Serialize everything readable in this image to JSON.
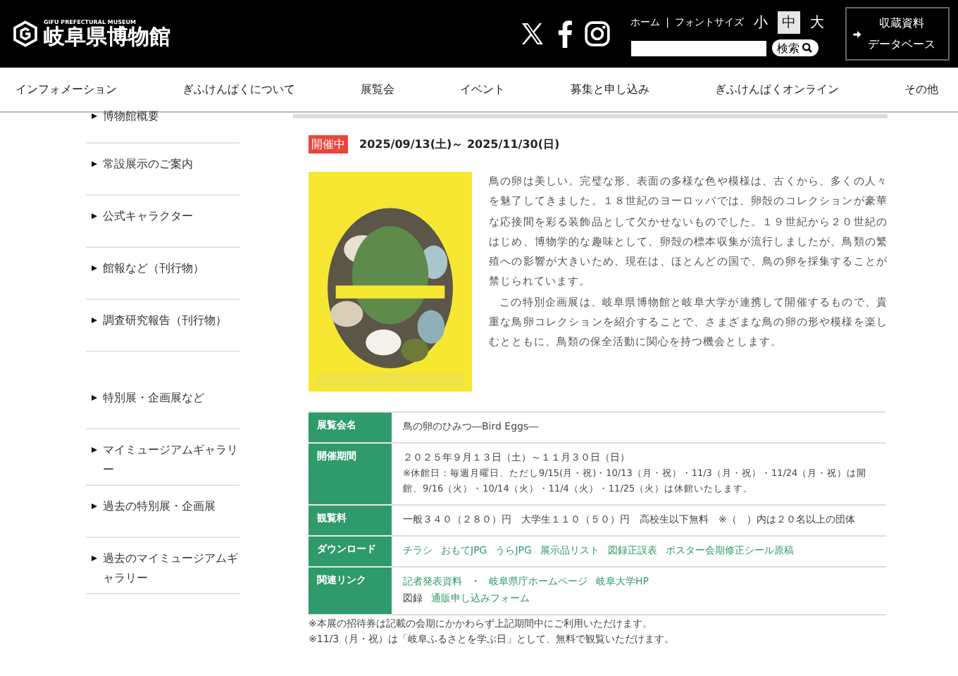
{
  "header": {
    "logo_caption": "GIFU PREFECTURAL MUSEUM",
    "logo_title": "岐阜県博物館",
    "top_links": [
      "ホーム",
      "|",
      "フォントサイズ"
    ],
    "font_sizes": [
      {
        "label": "小",
        "selected": false
      },
      {
        "label": "中",
        "selected": true
      },
      {
        "label": "大",
        "selected": false
      }
    ],
    "search_button": "検索",
    "database_button": [
      "収蔵資料",
      "データベース"
    ]
  },
  "nav": [
    "インフォメーション",
    "ぎふけんぱくについて",
    "展覧会",
    "イベント",
    "募集と申し込み",
    "ぎふけんぱくオンライン",
    "その他"
  ],
  "sidebar": {
    "groups": [
      [
        "博物館概要",
        "常設展示のご案内",
        "公式キャラクター",
        "館報など（刊行物）",
        "調査研究報告（刊行物）"
      ],
      [
        "特別展・企画展など",
        "マイミュージアムギャラリー",
        "過去の特別展・企画展",
        "過去のマイミュージアムギャラリー"
      ]
    ]
  },
  "exhibit": {
    "status": "開催中",
    "dates": "2025/09/13(土)～ 2025/11/30(日)",
    "poster": {
      "kind": "picture"
    },
    "paragraphs": [
      "鳥の卵は美しい。完璧な形、表面の多様な色や模様は、古くから、多くの人々を魅了してきました。１８世紀のヨーロッパでは、卵殻のコレクションが豪華な応接間を彩る装飾品として欠かせないものでした。１９世紀から２０世紀のはじめ、博物学的な趣味として、卵殻の標本収集が流行しましたが、鳥類の繁殖への影響が大きいため、現在は、ほとんどの国で、鳥の卵を採集することが禁じられています。",
      "この特別企画展は、岐阜県博物館と岐阜大学が連携して開催するもので、貴重な鳥卵コレクションを紹介することで、さまざまな鳥の卵の形や模様を楽しむとともに、鳥類の保全活動に関心を持つ機会とします。"
    ],
    "table": [
      {
        "label": "展覧会名",
        "lines": [
          [
            {
              "kind": "text",
              "text": "鳥の卵のひみつ―Bird Eggs―"
            }
          ]
        ]
      },
      {
        "label": "開催期間",
        "lines": [
          [
            {
              "kind": "text",
              "text": "２０２５年９月１３日（土）～１１月３０日（日）"
            }
          ],
          [
            {
              "kind": "small",
              "text": "※休館日：毎週月曜日、ただし9/15(月・祝)・10/13（月・祝）・11/3（月・祝）・11/24（月・祝）は開館、9/16（火）・10/14（火）・11/4（火）・11/25（火）は休館いたします。"
            }
          ]
        ]
      },
      {
        "label": "観覧料",
        "lines": [
          [
            {
              "kind": "text",
              "text": "一般３４０（２８０）円　大学生１１０（５０）円　高校生以下無料　※（　）内は２０名以上の団体"
            }
          ]
        ]
      },
      {
        "label": "ダウンロード",
        "lines": [
          [
            {
              "kind": "link",
              "text": "チラシ"
            },
            {
              "kind": "link",
              "text": "おもてJPG"
            },
            {
              "kind": "link",
              "text": "うらJPG"
            },
            {
              "kind": "link",
              "text": "展示品リスト"
            },
            {
              "kind": "link",
              "text": "図録正誤表"
            },
            {
              "kind": "link",
              "text": "ポスター会期修正シール原稿"
            }
          ]
        ]
      },
      {
        "label": "関連リンク",
        "lines": [
          [
            {
              "kind": "link",
              "text": "記者発表資料"
            },
            {
              "kind": "text",
              "text": "・"
            },
            {
              "kind": "link",
              "text": "岐阜県庁ホームページ"
            },
            {
              "kind": "link",
              "text": "岐阜大学HP"
            }
          ],
          [
            {
              "kind": "text",
              "text": "図録"
            },
            {
              "kind": "link",
              "text": "通販申し込みフォーム"
            }
          ]
        ]
      }
    ],
    "notes": [
      "※本展の招待券は記載の会期にかかわらず上記期間中にご利用いただけます。",
      "※11/3（月・祝）は「岐阜ふるさとを学ぶ日」として、無料で観覧いただけます。"
    ]
  }
}
